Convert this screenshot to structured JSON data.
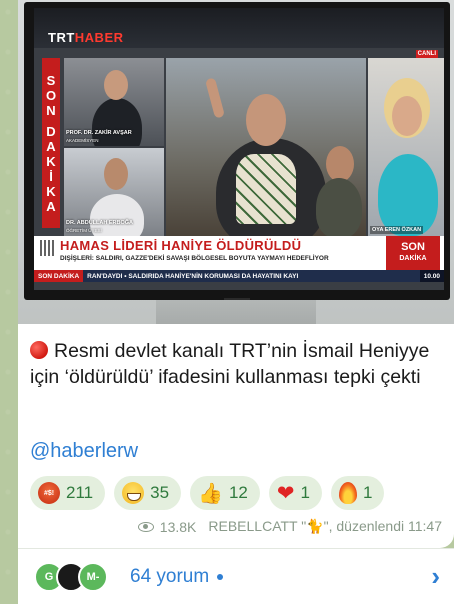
{
  "post": {
    "tv": {
      "channel_trt": "TRT",
      "channel_haber": "HABER",
      "live_badge": "CANLI",
      "son_dakika_vertical": [
        "S",
        "O",
        "N",
        "",
        "D",
        "A",
        "K",
        "İ",
        "K",
        "A"
      ],
      "guest1_name": "PROF. DR. ZAKİR AVŞAR",
      "guest1_title": "AKADEMİSYEN",
      "guest2_name": "DR. ABDULLAH ERBOĞA",
      "guest2_title": "ÖĞRETİM ÜYESİ",
      "anchor_name": "OYA EREN ÖZKAN",
      "headline": "HAMAS LİDERİ HANİYE ÖLDÜRÜLDÜ",
      "subline": "DIŞİŞLERİ: SALDIRI, GAZZE'DEKİ SAVAŞI BÖLGESEL BOYUTA YAYMAYI HEDEFLİYOR",
      "son_dakika_box_1": "SON",
      "son_dakika_box_2": "DAKİKA",
      "ticker_tag": "SON DAKİKA",
      "ticker_text": "RAN'DAYDI  •  SALDIRIDA HANİYE'NİN KORUMASI DA HAYATINI KAYI",
      "ticker_time": "10.00"
    },
    "message_text": "Resmi devlet kanalı TRT’nin İsmail Heniyye için ‘öldürüldü’ ifadesini kullanması tepki çekti",
    "mention": "@haberlerw",
    "reactions": [
      {
        "icon": "angry-face-icon",
        "count": "211"
      },
      {
        "icon": "grinning-face-icon",
        "count": "35"
      },
      {
        "icon": "thumbs-up-icon",
        "count": "12"
      },
      {
        "icon": "heart-icon",
        "count": "1"
      },
      {
        "icon": "fire-icon",
        "count": "1"
      }
    ],
    "meta": {
      "views": "13.8K",
      "author": "REBELLCATT \"🐈\", düzenlendi 11:47"
    }
  },
  "comments_bar": {
    "avatar_1": "G",
    "avatar_3": "M-",
    "label": "64 yorum"
  },
  "colors": {
    "accent": "#2f7fd3",
    "reaction_bg": "#e4efde",
    "reaction_text": "#2f7a3d",
    "trt_red": "#c41d1d"
  }
}
